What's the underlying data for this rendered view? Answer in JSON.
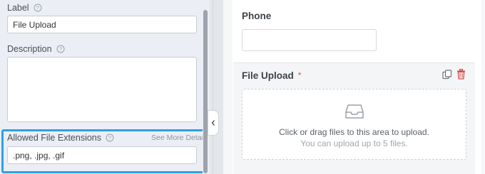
{
  "settings": {
    "label": {
      "title": "Label",
      "value": "File Upload"
    },
    "description": {
      "title": "Description",
      "value": ""
    },
    "allowed_extensions": {
      "title": "Allowed File Extensions",
      "see_more": "See More Details",
      "value": ".png, .jpg, .gif"
    },
    "help_icon": "question-circle-icon"
  },
  "preview": {
    "phone": {
      "label": "Phone",
      "value": ""
    },
    "file_upload": {
      "label": "File Upload",
      "required_mark": "*",
      "drop_text": "Click or drag files to this area to upload.",
      "limit_text": "You can upload up to 5 files.",
      "icons": [
        "duplicate-icon",
        "trash-icon",
        "inbox-tray-icon"
      ]
    }
  },
  "colors": {
    "highlight": "#2ea1e6",
    "danger": "#d0524f",
    "panel": "#ebeff5"
  }
}
